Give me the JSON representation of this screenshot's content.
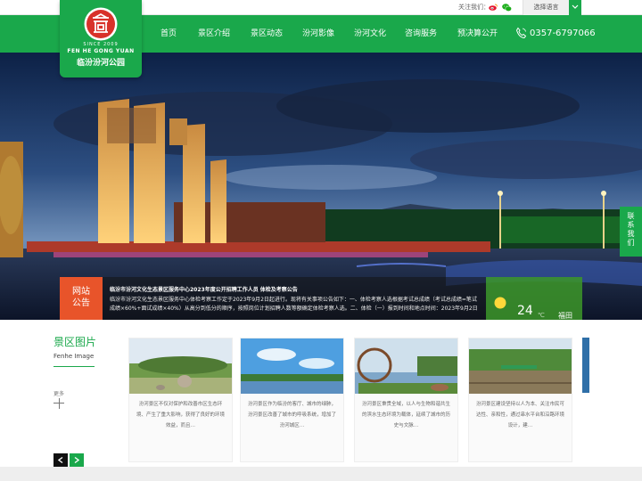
{
  "topbar": {
    "follow_label": "关注我们：",
    "language_label": "选择语言"
  },
  "logo": {
    "since": "SINCE 2009",
    "name_en": "FEN HE GONG YUAN",
    "name_cn": "临汾汾河公园"
  },
  "nav": {
    "items": [
      "首页",
      "景区介绍",
      "景区动态",
      "汾河影像",
      "汾河文化",
      "咨询服务",
      "预决算公开"
    ],
    "phone": "0357-6797066"
  },
  "side_contact": {
    "label": "联系我们"
  },
  "notice": {
    "label_line1": "网站",
    "label_line2": "公告",
    "title": "临汾市汾河文化生态景区服务中心2023年度公开招聘工作人员 体检及考察公告",
    "body": "临汾市汾河文化生态景区服务中心体检考察工作定于2023年9月2日起进行。现将有关事项公告如下：一、体检考察人选根据考试总成绩（考试总成绩=笔试成绩×60%+面试成绩×40%）从高分到低分的顺序，按照岗位计划招聘人数等额确定体检考察人选。二、体检（一）报到时间和地点时间：2023年9月2日"
  },
  "weather": {
    "temperature": "24",
    "unit": "℃",
    "city": "福田"
  },
  "gallery": {
    "title": "景区图片",
    "subtitle": "Fenhe Image",
    "more": "更多",
    "cards": [
      {
        "text": "汾河景区不仅对保护和改善市区生态环境、产生了重大影响，获得了良好的环境效益，而且…"
      },
      {
        "text": "汾河景区作为临汾的客厅、城市的绿肺，汾河景区改善了城市的呼吸系统，增加了汾河城区…"
      },
      {
        "text": "汾河景区秉贯全域，以人与生物和谐共生的滨水生态环境为载体，延续了城市的历史与文脉…"
      },
      {
        "text": "汾河景区建设坚持以人为本、关注市民可达性、亲和性，通过串水平台和沿路环境设计，建…"
      }
    ]
  },
  "colors": {
    "brand_green": "#1aa84b",
    "notice_orange": "#e8542a",
    "logo_red": "#d8322a"
  }
}
